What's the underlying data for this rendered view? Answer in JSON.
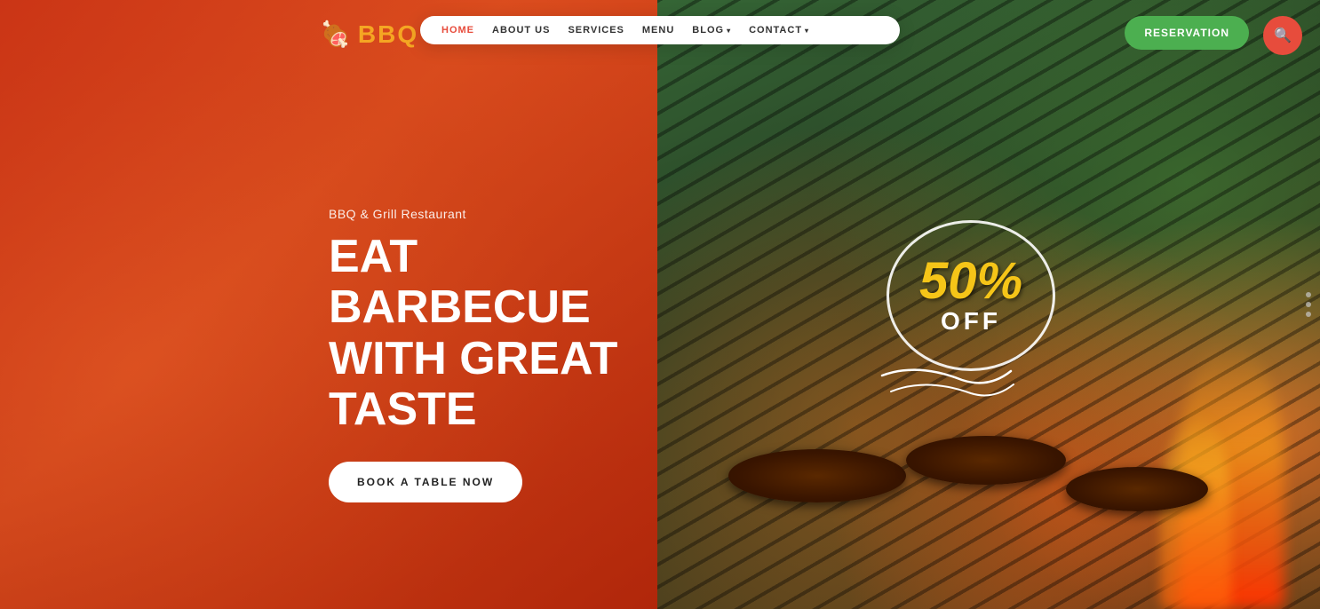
{
  "logo": {
    "icon": "🍖",
    "text": "BBQ"
  },
  "navbar": {
    "links": [
      {
        "id": "home",
        "label": "HOME",
        "active": true,
        "hasArrow": false
      },
      {
        "id": "about",
        "label": "ABOUT US",
        "active": false,
        "hasArrow": false
      },
      {
        "id": "services",
        "label": "SERVICES",
        "active": false,
        "hasArrow": false
      },
      {
        "id": "menu",
        "label": "MENU",
        "active": false,
        "hasArrow": false
      },
      {
        "id": "blog",
        "label": "BLOG",
        "active": false,
        "hasArrow": true
      },
      {
        "id": "contact",
        "label": "CONTACT",
        "active": false,
        "hasArrow": true
      }
    ],
    "reservation_label": "RESERVATION"
  },
  "hero": {
    "subtitle": "BBQ & Grill Restaurant",
    "title": "EAT BARBECUE WITH GREAT TASTE",
    "cta_label": "BOOK A TABLE NOW"
  },
  "discount": {
    "percent": "50%",
    "label": "OFF"
  }
}
